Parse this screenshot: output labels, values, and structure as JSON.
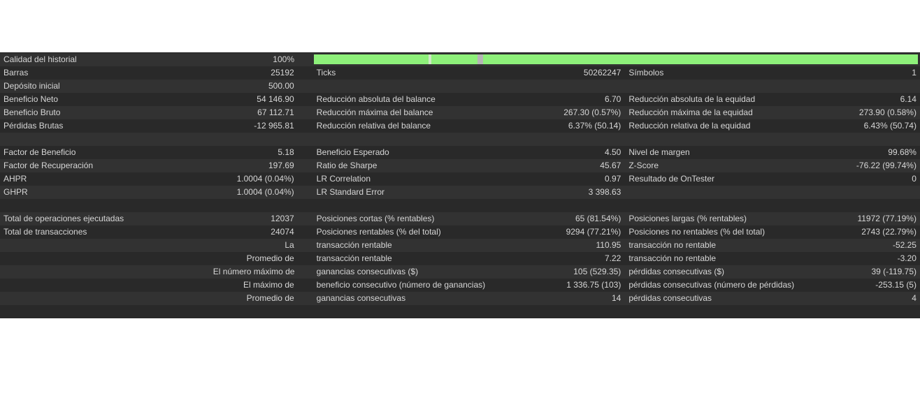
{
  "history_quality": {
    "label": "Calidad del historial",
    "value": "100%",
    "bar_fill_fraction": 1.0,
    "bar_color": "#8ef07a"
  },
  "rows": [
    {
      "c1": [
        "Barras",
        "25192"
      ],
      "c2": [
        "Ticks",
        "50262247"
      ],
      "c3": [
        "Símbolos",
        "1"
      ]
    },
    {
      "c1": [
        "Depósito inicial",
        "500.00"
      ],
      "c2": [
        "",
        ""
      ],
      "c3": [
        "",
        ""
      ]
    },
    {
      "c1": [
        "Beneficio Neto",
        "54 146.90"
      ],
      "c2": [
        "Reducción absoluta del balance",
        "6.70"
      ],
      "c3": [
        "Reducción absoluta de la equidad",
        "6.14"
      ]
    },
    {
      "c1": [
        "Beneficio Bruto",
        "67 112.71"
      ],
      "c2": [
        "Reducción máxima del balance",
        "267.30 (0.57%)"
      ],
      "c3": [
        "Reducción máxima de la equidad",
        "273.90 (0.58%)"
      ]
    },
    {
      "c1": [
        "Pérdidas Brutas",
        "-12 965.81"
      ],
      "c2": [
        "Reducción relativa del balance",
        "6.37% (50.14)"
      ],
      "c3": [
        "Reducción relativa de la equidad",
        "6.43% (50.74)"
      ]
    },
    {
      "c1": [
        "",
        ""
      ],
      "c2": [
        "",
        ""
      ],
      "c3": [
        "",
        ""
      ]
    },
    {
      "c1": [
        "Factor de Beneficio",
        "5.18"
      ],
      "c2": [
        "Beneficio Esperado",
        "4.50"
      ],
      "c3": [
        "Nivel de margen",
        "99.68%"
      ]
    },
    {
      "c1": [
        "Factor de Recuperación",
        "197.69"
      ],
      "c2": [
        "Ratio de Sharpe",
        "45.67"
      ],
      "c3": [
        "Z-Score",
        "-76.22 (99.74%)"
      ]
    },
    {
      "c1": [
        "AHPR",
        "1.0004 (0.04%)"
      ],
      "c2": [
        "LR Correlation",
        "0.97"
      ],
      "c3": [
        "Resultado de OnTester",
        "0"
      ]
    },
    {
      "c1": [
        "GHPR",
        "1.0004 (0.04%)"
      ],
      "c2": [
        "LR Standard Error",
        "3 398.63"
      ],
      "c3": [
        "",
        ""
      ]
    },
    {
      "c1": [
        "",
        ""
      ],
      "c2": [
        "",
        ""
      ],
      "c3": [
        "",
        ""
      ]
    },
    {
      "c1": [
        "Total de operaciones ejecutadas",
        "12037"
      ],
      "c2": [
        "Posiciones cortas (% rentables)",
        "65 (81.54%)"
      ],
      "c3": [
        "Posiciones largas (% rentables)",
        "11972 (77.19%)"
      ]
    },
    {
      "c1": [
        "Total de transacciones",
        "24074"
      ],
      "c2": [
        "Posiciones rentables (% del total)",
        "9294 (77.21%)"
      ],
      "c3": [
        "Posiciones no rentables (% del total)",
        "2743 (22.79%)"
      ]
    },
    {
      "c1": [
        "",
        "La"
      ],
      "c2": [
        "transacción rentable",
        "110.95"
      ],
      "c3": [
        "transacción no rentable",
        "-52.25"
      ]
    },
    {
      "c1": [
        "",
        "Promedio de"
      ],
      "c2": [
        "transacción rentable",
        "7.22"
      ],
      "c3": [
        "transacción no rentable",
        "-3.20"
      ]
    },
    {
      "c1": [
        "",
        "El número máximo de"
      ],
      "c2": [
        "ganancias consecutivas ($)",
        "105 (529.35)"
      ],
      "c3": [
        "pérdidas consecutivas ($)",
        "39 (-119.75)"
      ]
    },
    {
      "c1": [
        "",
        "El máximo de"
      ],
      "c2": [
        "beneficio consecutivo (número de ganancias)",
        "1 336.75 (103)"
      ],
      "c3": [
        "pérdidas consecutivas (número de pérdidas)",
        "-253.15 (5)"
      ]
    },
    {
      "c1": [
        "",
        "Promedio de"
      ],
      "c2": [
        "ganancias consecutivas",
        "14"
      ],
      "c3": [
        "pérdidas consecutivas",
        "4"
      ]
    },
    {
      "c1": [
        "",
        ""
      ],
      "c2": [
        "",
        ""
      ],
      "c3": [
        "",
        ""
      ]
    }
  ]
}
